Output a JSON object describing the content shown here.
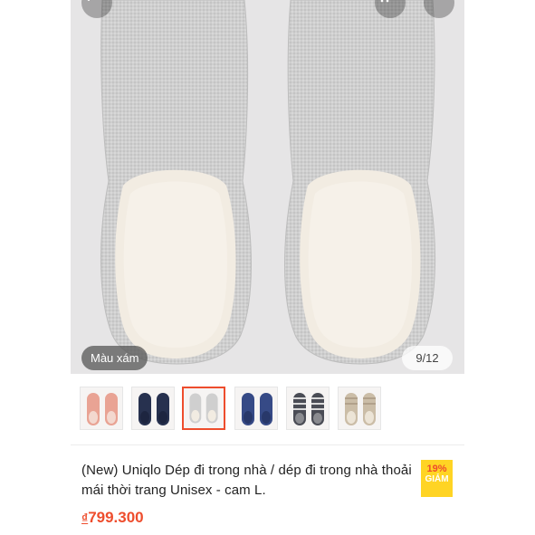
{
  "gallery": {
    "color_label": "Màu xám",
    "counter": "9/12"
  },
  "thumbnails": [
    {
      "name": "thumb-pink",
      "color": "#e9a394"
    },
    {
      "name": "thumb-navy",
      "color": "#27314f"
    },
    {
      "name": "thumb-gray",
      "color": "#cfcfcf",
      "selected": true
    },
    {
      "name": "thumb-blue",
      "color": "#364a86"
    },
    {
      "name": "thumb-stripe-dark",
      "color": "#4a4c55"
    },
    {
      "name": "thumb-beige",
      "color": "#cbbda7"
    }
  ],
  "product": {
    "title": "(New) Uniqlo Dép đi trong nhà / dép đi trong nhà thoải mái thời trang Unisex - cam L.",
    "discount_percent": "19%",
    "discount_word": "GIẢM",
    "price_currency": "₫",
    "price_value": "799.300"
  },
  "colors": {
    "accent": "#ee4d2d",
    "badge": "#ffd424"
  },
  "icons": [
    "arrow-left-icon",
    "cart-icon",
    "more-icon"
  ]
}
